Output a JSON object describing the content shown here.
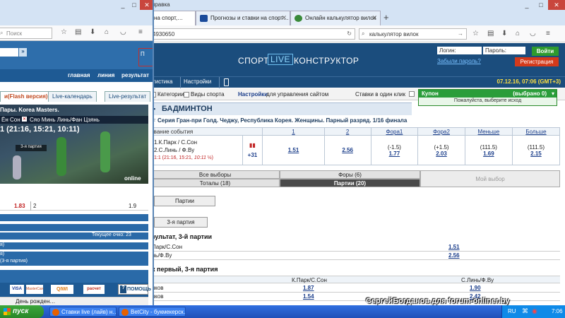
{
  "right_window": {
    "tab0_partial": "на спорт,…",
    "tab1": "Прогнозы и ставки на спорт…",
    "tab2": "Онлайн калькулятор вилок",
    "new_tab": "+",
    "title_partial": "правка",
    "url_partial": "4930650",
    "search_value": "калькулятор вилок",
    "site": {
      "nav_sport": "СПОРТ",
      "nav_live": "LIVE",
      "nav_constructor": "КОНСТРУКТОР",
      "login_label": "Логин:",
      "password_label": "Пароль:",
      "login_button": "Войти",
      "forgot": "Забыли пароль?",
      "register_button": "Регистрация",
      "toolbar_stats": "тистика",
      "toolbar_settings": "Настройки",
      "datetime": "07.12.16, 07:06 (GMT+3)",
      "categories": "Категории",
      "sport_types": "Виды спорта",
      "settings_link": "Настройки",
      "settings_hint": "для управления сайтом",
      "one_click": "Ставки в один клик",
      "coupon_title": "Купон",
      "coupon_count": "(выбрано 0)",
      "coupon_msg": "Пожалуйста, выберите исход",
      "sport": "БАДМИНТОН",
      "event_title": "Серия Гран-при Голд. Чеджу, Республика Корея. Женщины. Парный разряд. 1/16 финала",
      "odds_headers": [
        "звание события",
        "1",
        "2",
        "Фора1",
        "Фора2",
        "Меньше",
        "Больше"
      ],
      "team1": "1.К.Парк / С.Сон",
      "team2": "2.С.Линь / Ф.Ву",
      "score": "1:1 (21:16, 15:21,",
      "score_time": "10:11",
      "score_tail": "½)",
      "more_count": "+31",
      "odd1": "1.51",
      "odd2": "2.56",
      "fora1_line": "(-1.5)",
      "fora1_val": "1.77",
      "fora2_line": "(+1.5)",
      "fora2_val": "2.03",
      "under_line": "(111.5)",
      "under_val": "1.69",
      "over_line": "(111.5)",
      "over_val": "2.15",
      "tab_all": "Все выборы",
      "tab_foras": "Форы (6)",
      "tab_my": "Мой выбор",
      "tab_totals": "Тоталы (18)",
      "tab_parties": "Партии (20)",
      "btn_parties": "Партии",
      "btn_third": "3-я партия",
      "sec1_title": "зультат, 3-й партии",
      "sec1_row1_name": "Парк/С.Сон",
      "sec1_row1_val": "1.51",
      "sec1_row2_name": "нь/Ф.Ву",
      "sec1_row2_val": "2.56",
      "sec2_title": "к первый, 3-я партия",
      "sec2_col1": "К.Парк/С.Сон",
      "sec2_col2": "С.Линь/Ф.Ву",
      "sec2_row1_name": "чков",
      "sec2_row1_v1": "1.87",
      "sec2_row1_v2": "1.90",
      "sec2_row2_name": "чков",
      "sec2_row2_v1": "1.54",
      "sec2_row2_v2": "2.42"
    }
  },
  "left_window": {
    "search_placeholder": "Поиск",
    "menu_main": "главная",
    "menu_line": "линия",
    "menu_results": "результат",
    "tab_flash": "и(Flash версия)",
    "tab_calendar": "Live-календарь",
    "tab_results": "Live-результат",
    "video_title": "Пары. Korea Masters.",
    "video_team_left": "Ён Сон",
    "video_team_right": "Сяо Минь Линь/Фан Цзянь",
    "video_score": "1 (21:16, 15:21, 10:11)",
    "video_caption": "3-я партия",
    "video_brand": "online",
    "row_odd1": "1.83",
    "row_mid": "2",
    "row_odd2": "1.9",
    "current_score": "Текущее очко: 23",
    "side_1": "я)",
    "side_2": "я)",
    "side_3": "(3-я партия)",
    "help": "ПОМОЩЬ",
    "news_item": "День рожден…",
    "payment_logos": [
      "VISA",
      "MasterCard",
      "QIWI",
      "расчет"
    ]
  },
  "taskbar": {
    "start": "пуск",
    "task1": "Ставки live (лайв) н…",
    "task2": "BetCity - букмекерск…",
    "lang": "RU",
    "clock": "7:06"
  },
  "watermark": "СергейБогданов для forum-onliner.by",
  "colors": {
    "site_header": "#1b4d7d",
    "accent_green": "#2a9d3a",
    "register_red": "#d43a1b",
    "date_yellow": "#ffe040"
  }
}
